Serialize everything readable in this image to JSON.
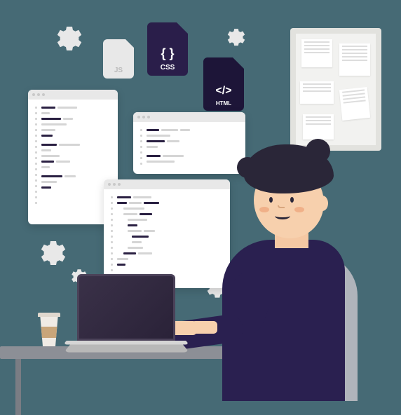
{
  "files": {
    "js_label": "JS",
    "css_label": "CSS",
    "html_label": "HTML",
    "css_glyph": "{ }",
    "html_glyph": "</>"
  },
  "icons": {
    "gear": "gear-icon",
    "coffee": "coffee-cup-icon"
  }
}
